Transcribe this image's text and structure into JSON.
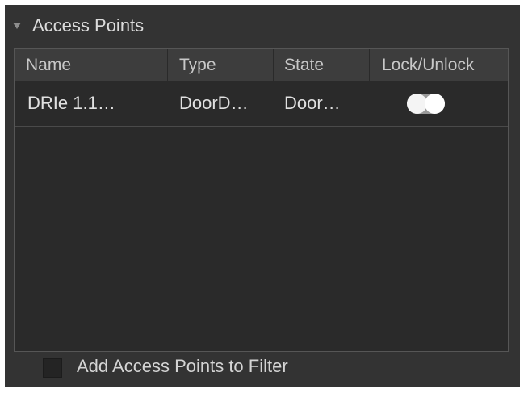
{
  "panel": {
    "title": "Access Points",
    "expanded": true,
    "icon": "triangle-down-icon"
  },
  "table": {
    "columns": [
      "Name",
      "Type",
      "State",
      "Lock/Unlock"
    ],
    "rows": [
      {
        "name": "DRIe 1.1…",
        "type": "DoorD…",
        "state": "Door…",
        "locked": false
      }
    ]
  },
  "filter": {
    "label": "Add Access Points to Filter",
    "checked": false
  }
}
